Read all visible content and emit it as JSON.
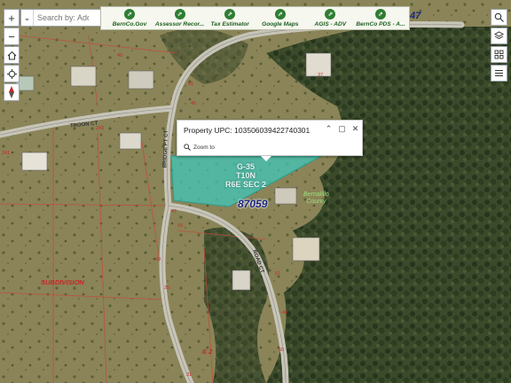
{
  "search": {
    "placeholder": "Search by: Add..."
  },
  "links": [
    {
      "label": "BernCo.Gov",
      "icon": "link-icon"
    },
    {
      "label": "Assessor Recor...",
      "icon": "link-icon"
    },
    {
      "label": "Tax Estimator",
      "icon": "link-icon"
    },
    {
      "label": "Google Maps",
      "icon": "link-icon"
    },
    {
      "label": "AGIS - ADV",
      "icon": "link-icon"
    },
    {
      "label": "BernCo PDS - A...",
      "icon": "link-icon"
    }
  ],
  "linkbar_tail": "47",
  "popup": {
    "title": "Property UPC: 103506039422740301",
    "zoom_label": "Zoom to"
  },
  "map_labels": {
    "parcel_line1": "G-35",
    "parcel_line2": "T10N",
    "parcel_line3": "R6E SEC 2",
    "zip": "87059",
    "subdivision": "SUBDIVISION",
    "subdivision2": "S 2",
    "green_line1": "Bernalillo",
    "green_line2": "County",
    "street_troon": "TROON CT",
    "street_vertical": "BRIDGE PT CT",
    "street_lower": "ROAD CT"
  },
  "lot_numbers": [
    "243",
    "241",
    "91",
    "47",
    "43",
    "49",
    "35",
    "45",
    "51",
    "37",
    "40",
    "49",
    "50",
    "31"
  ],
  "colors": {
    "parcel_fill": "#3fc7b9",
    "link_green": "#2e7d32",
    "zip_blue": "#1a237e",
    "subdivision_red": "#c62828"
  }
}
